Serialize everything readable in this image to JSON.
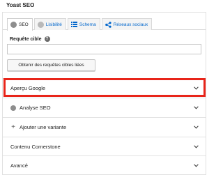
{
  "panel": {
    "title": "Yoast SEO"
  },
  "tabs": [
    {
      "label": "SEO",
      "icon": "seo-status-dot-icon"
    },
    {
      "label": "Lisibilité",
      "icon": "readability-status-dot-icon"
    },
    {
      "label": "Schema",
      "icon": "schema-grid-icon"
    },
    {
      "label": "Réseaux sociaux",
      "icon": "share-icon"
    }
  ],
  "focus_keyphrase": {
    "label": "Requête cible",
    "value": "",
    "help_icon": "question-icon"
  },
  "related_button": {
    "label": "Obtenir des requêtes cibles liées"
  },
  "sections": [
    {
      "label": "Aperçu Google",
      "icon": "chevron-down-icon"
    },
    {
      "label": "Analyse SEO",
      "prefix_icon": "status-dot-icon",
      "icon": "chevron-down-icon"
    },
    {
      "label": "Ajouter une variante",
      "prefix_icon": "plus-icon",
      "icon": "chevron-down-icon"
    },
    {
      "label": "Contenu Cornerstone",
      "icon": "chevron-down-icon"
    },
    {
      "label": "Avancé",
      "icon": "chevron-down-icon"
    }
  ],
  "colors": {
    "highlight": "#e8251a",
    "link": "#0066cc",
    "status_gray": "#8e8e8e"
  }
}
